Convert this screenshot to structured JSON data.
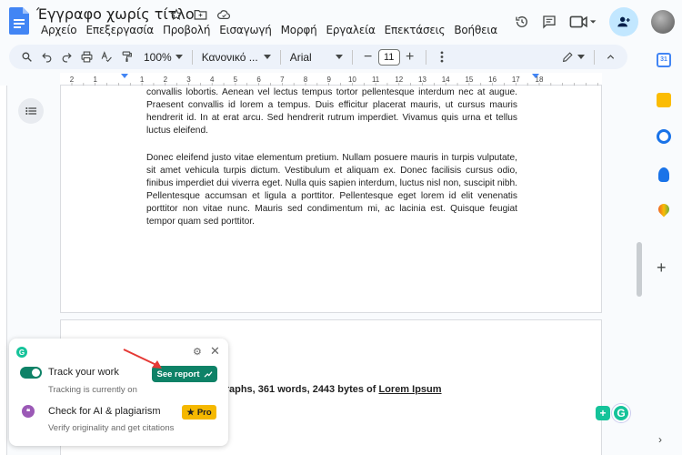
{
  "app": {
    "title": "Έγγραφο χωρίς τίτλο",
    "menus": [
      "Αρχείο",
      "Επεξεργασία",
      "Προβολή",
      "Εισαγωγή",
      "Μορφή",
      "Εργαλεία",
      "Επεκτάσεις",
      "Βοήθεια"
    ]
  },
  "toolbar": {
    "zoom": "100%",
    "style": "Κανονικό ...",
    "font": "Arial",
    "font_size": "11",
    "minus": "−",
    "plus": "+"
  },
  "ruler": {
    "labels": [
      "2",
      "1",
      "1",
      "2",
      "3",
      "4",
      "5",
      "6",
      "7",
      "8",
      "9",
      "10",
      "11",
      "12",
      "13",
      "14",
      "15",
      "16",
      "17",
      "18"
    ]
  },
  "document": {
    "para1": "convallis lobortis. Aenean vel lectus tempus tortor pellentesque interdum nec at augue. Praesent convallis id lorem a tempus. Duis efficitur placerat mauris, ut cursus mauris hendrerit id. In at erat arcu. Sed hendrerit rutrum imperdiet. Vivamus quis urna et tellus luctus eleifend.",
    "para2": "Donec eleifend justo vitae elementum pretium. Nullam posuere mauris in turpis vulputate, sit amet vehicula turpis dictum. Vestibulum et aliquam ex. Donec facilisis cursus odio, finibus imperdiet dui viverra eget. Nulla quis sapien interdum, luctus nisl non, suscipit nibh. Pellentesque accumsan et ligula a porttitor. Pellentesque eget lorem id elit venenatis porttitor non vitae nunc. Mauris sed condimentum mi, ac lacinia est. Quisque feugiat tempor quam sed porttitor.",
    "stats_text": "graphs, 361 words, 2443 bytes of ",
    "stats_link": "Lorem Ipsum"
  },
  "grammarly": {
    "logo": "G",
    "track_title": "Track your work",
    "track_sub": "Tracking is currently on",
    "see_report": "See report",
    "ai_title": "Check for AI & plagiarism",
    "ai_sub": "Verify originality and get citations",
    "pro": "Pro",
    "colors": {
      "brand": "#15c39a",
      "button": "#0e8267",
      "pro": "#f5b800"
    }
  },
  "side_panel": {
    "calendar_day": "31"
  },
  "icons": [
    "search-icon",
    "undo-icon",
    "redo-icon",
    "print-icon",
    "spellcheck-icon",
    "paint-format-icon",
    "more-icon",
    "pencil-icon",
    "chevron-up-icon",
    "history-icon",
    "comment-icon",
    "video-icon",
    "share-icon",
    "star-icon",
    "folder-icon",
    "cloud-icon",
    "outline-icon",
    "plus-icon",
    "chevron-right-icon"
  ]
}
